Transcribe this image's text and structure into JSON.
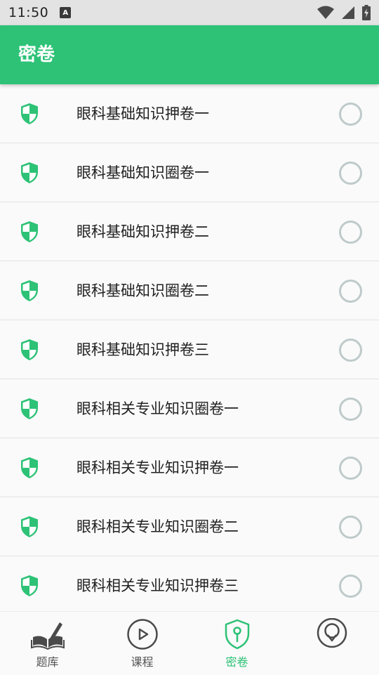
{
  "status_bar": {
    "time": "11:50",
    "notification_icon": "A"
  },
  "app_bar": {
    "title": "密卷"
  },
  "list": {
    "items": [
      {
        "label": "眼科基础知识押卷一"
      },
      {
        "label": "眼科基础知识圈卷一"
      },
      {
        "label": "眼科基础知识押卷二"
      },
      {
        "label": "眼科基础知识圈卷二"
      },
      {
        "label": "眼科基础知识押卷三"
      },
      {
        "label": "眼科相关专业知识圈卷一"
      },
      {
        "label": "眼科相关专业知识押卷一"
      },
      {
        "label": "眼科相关专业知识圈卷二"
      },
      {
        "label": "眼科相关专业知识押卷三"
      }
    ]
  },
  "bottom_nav": {
    "tabs": [
      {
        "label": "题库",
        "icon": "book-pen-icon"
      },
      {
        "label": "课程",
        "icon": "play-circle-icon"
      },
      {
        "label": "密卷",
        "icon": "keyhole-shield-icon",
        "active": true
      },
      {
        "label": "",
        "icon": "profile-circle-icon"
      }
    ]
  },
  "colors": {
    "accent": "#2dc276",
    "radio_border": "#bfcaca"
  }
}
